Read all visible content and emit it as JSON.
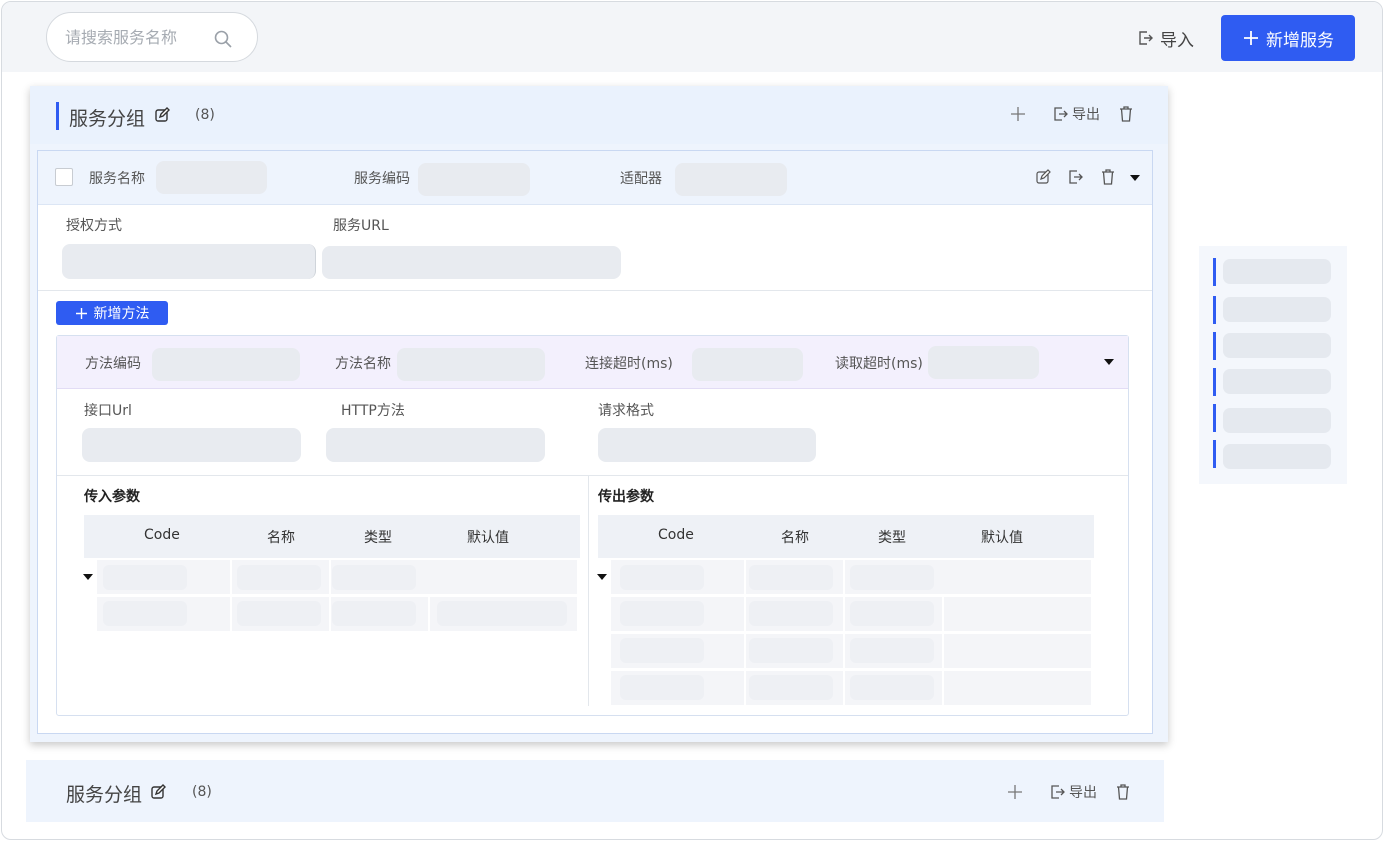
{
  "topbar": {
    "search_placeholder": "请搜索服务名称",
    "import_label": "导入",
    "add_service_label": "新增服务"
  },
  "groups": [
    {
      "title": "服务分组",
      "count": "(8)",
      "export_label": "导出"
    },
    {
      "title": "服务分组",
      "count": "(8)",
      "export_label": "导出"
    }
  ],
  "service": {
    "name_label": "服务名称",
    "code_label": "服务编码",
    "adapter_label": "适配器",
    "auth_label": "授权方式",
    "url_label": "服务URL",
    "add_method_label": "新增方法"
  },
  "method": {
    "code_label": "方法编码",
    "name_label": "方法名称",
    "connect_timeout_label": "连接超时(ms)",
    "read_timeout_label": "读取超时(ms)",
    "api_url_label": "接口Url",
    "http_method_label": "HTTP方法",
    "request_format_label": "请求格式"
  },
  "params": {
    "in_title": "传入参数",
    "out_title": "传出参数",
    "columns": [
      "Code",
      "名称",
      "类型",
      "默认值"
    ]
  },
  "icons": [
    "search-icon",
    "import-icon",
    "plus-icon",
    "edit-icon",
    "export-icon",
    "trash-icon",
    "caret-down-icon"
  ],
  "colors": {
    "accent": "#2f5cf2",
    "group_bg": "#eef4fd",
    "method_head_bg": "#f3f0fd"
  }
}
